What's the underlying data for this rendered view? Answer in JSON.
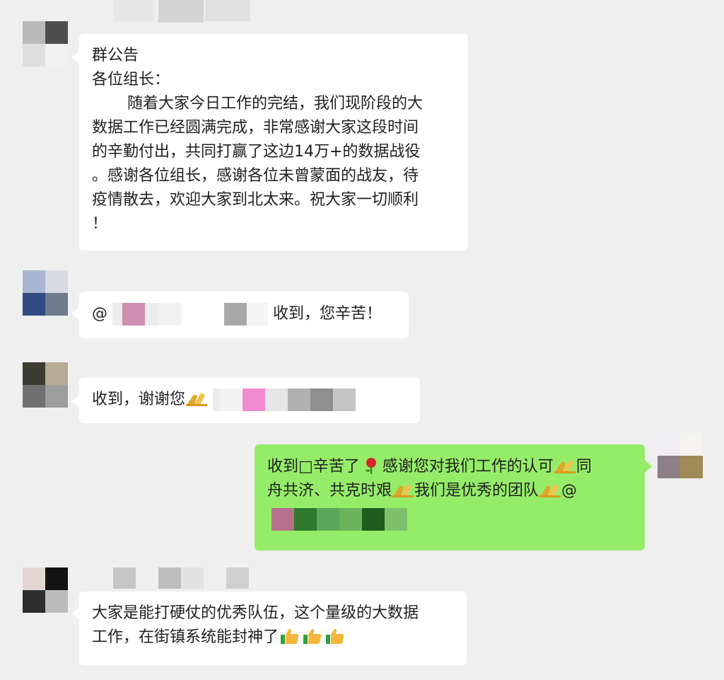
{
  "messages": {
    "announcement": {
      "title": "群公告",
      "greeting": "各位组长：",
      "lines": [
        "随着大家今日工作的完结，我们现阶段的大",
        "数据工作已经圆满完成，非常感谢大家这段时间",
        "的辛勤付出，共同打赢了这边14万+的数据战役",
        "。感谢各位组长，感谢各位未曾蒙面的战友，待",
        "疫情散去，欢迎大家到北太来。祝大家一切顺利",
        "！"
      ]
    },
    "reply1": {
      "at": "@",
      "text": "收到，您辛苦！"
    },
    "reply2": {
      "text": "收到，谢谢您"
    },
    "self_reply": {
      "line1a": "收到□辛苦了",
      "line1b": "感谢您对我们工作的认可",
      "line1c": "同",
      "line2a": "舟共济、共克时艰",
      "line2b": "我们是优秀的团队",
      "line2c": "@"
    },
    "reply3": {
      "line1": "大家是能打硬仗的优秀队伍，这个量级的大数据",
      "line2": "工作，在街镇系统能封神了"
    }
  },
  "icons": [
    "rose-emoji",
    "fist-bump-emoji",
    "thumbs-up-emoji"
  ],
  "colors": {
    "background": "#efefef",
    "bubble_white": "#ffffff",
    "bubble_green": "#95ec69",
    "text": "#1f1f1f"
  }
}
